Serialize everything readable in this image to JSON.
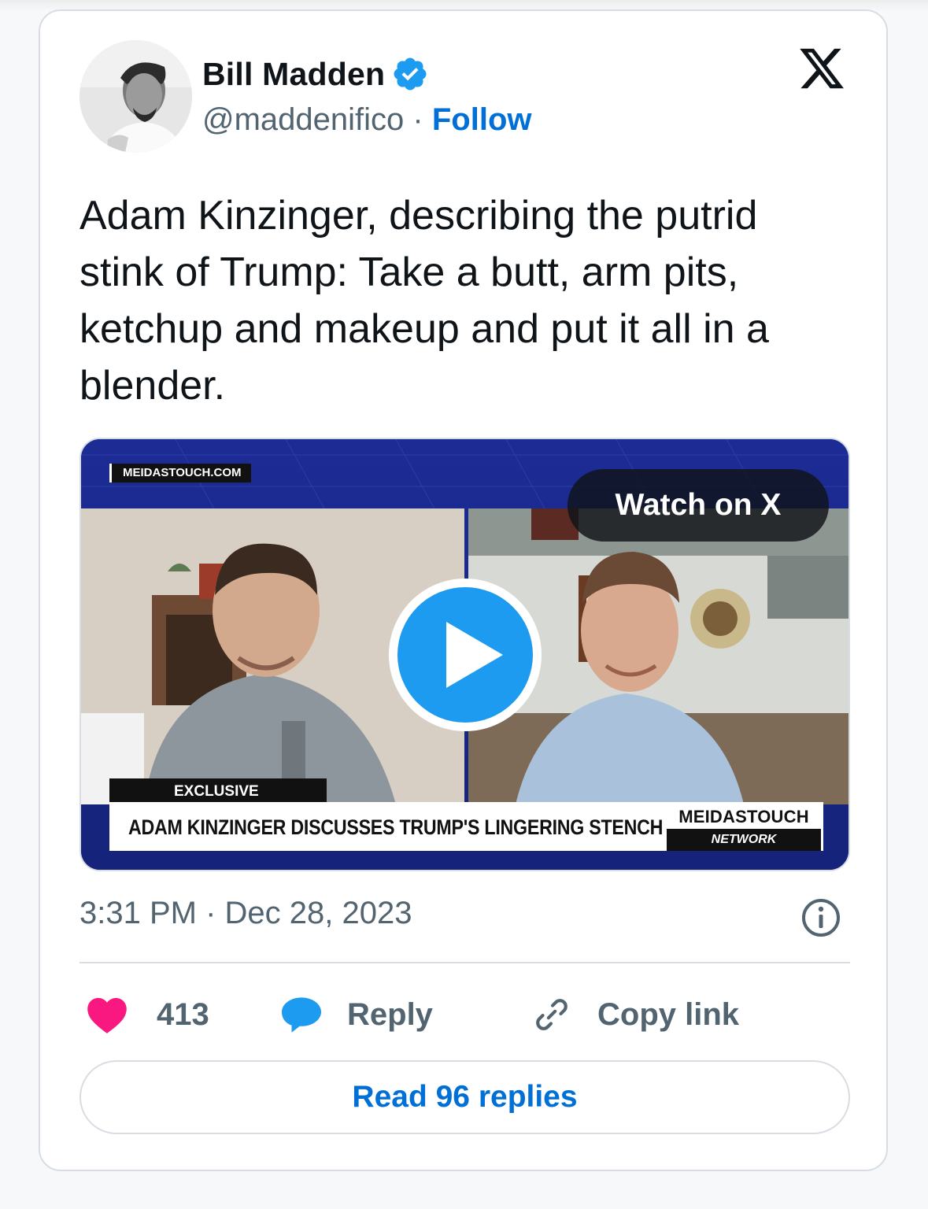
{
  "author": {
    "name": "Bill Madden",
    "handle": "@maddenifico",
    "separator": "·",
    "follow_label": "Follow"
  },
  "tweet": {
    "text": "Adam Kinzinger, describing the putrid stink of Trump: Take a butt, arm pits, ketchup and makeup and put it all in a blender."
  },
  "media": {
    "brand_tag": "MEIDASTOUCH.COM",
    "watch_label": "Watch on X",
    "exclusive_label": "EXCLUSIVE",
    "headline": "ADAM KINZINGER DISCUSSES TRUMP'S LINGERING STENCH",
    "network_top": "MEIDASTOUCH",
    "network_bottom": "NETWORK"
  },
  "timestamp": "3:31 PM · Dec 28, 2023",
  "actions": {
    "like_count": "413",
    "reply_label": "Reply",
    "copy_label": "Copy link"
  },
  "read_replies_label": "Read 96 replies",
  "colors": {
    "accent": "#006fd6",
    "verified": "#1d9bf0",
    "like": "#f91880",
    "reply": "#1d9bf0",
    "muted": "#536471",
    "text": "#0f1419"
  },
  "icons": [
    "verified-badge-icon",
    "x-logo-icon",
    "play-icon",
    "info-icon",
    "heart-icon",
    "reply-bubble-icon",
    "link-icon"
  ]
}
